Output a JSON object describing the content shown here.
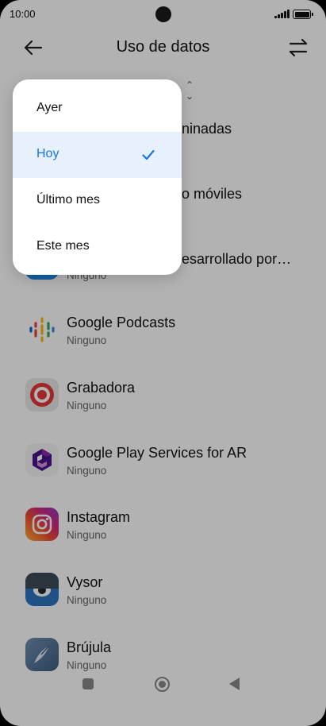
{
  "status_bar": {
    "time": "10:00"
  },
  "header": {
    "title": "Uso de datos"
  },
  "colors": {
    "accent": "#1a73e8",
    "selected_bg": "#e7f1fd"
  },
  "behind_menu": [
    {
      "text": "ninadas"
    },
    {
      "text": "o móviles"
    },
    {
      "text": "esarrollado por…"
    },
    {
      "text": "Ninguno"
    }
  ],
  "apps": [
    {
      "name": "Google Podcasts",
      "usage": "Ninguno",
      "icon": "google-podcasts-icon"
    },
    {
      "name": "Grabadora",
      "usage": "Ninguno",
      "icon": "recorder-icon"
    },
    {
      "name": "Google Play Services for AR",
      "usage": "Ninguno",
      "icon": "arcore-icon"
    },
    {
      "name": "Instagram",
      "usage": "Ninguno",
      "icon": "instagram-icon"
    },
    {
      "name": "Vysor",
      "usage": "Ninguno",
      "icon": "vysor-icon"
    },
    {
      "name": "Brújula",
      "usage": "Ninguno",
      "icon": "compass-icon"
    }
  ],
  "dropdown": {
    "options": [
      {
        "label": "Ayer",
        "selected": false
      },
      {
        "label": "Hoy",
        "selected": true
      },
      {
        "label": "Último mes",
        "selected": false
      },
      {
        "label": "Este mes",
        "selected": false
      }
    ]
  }
}
